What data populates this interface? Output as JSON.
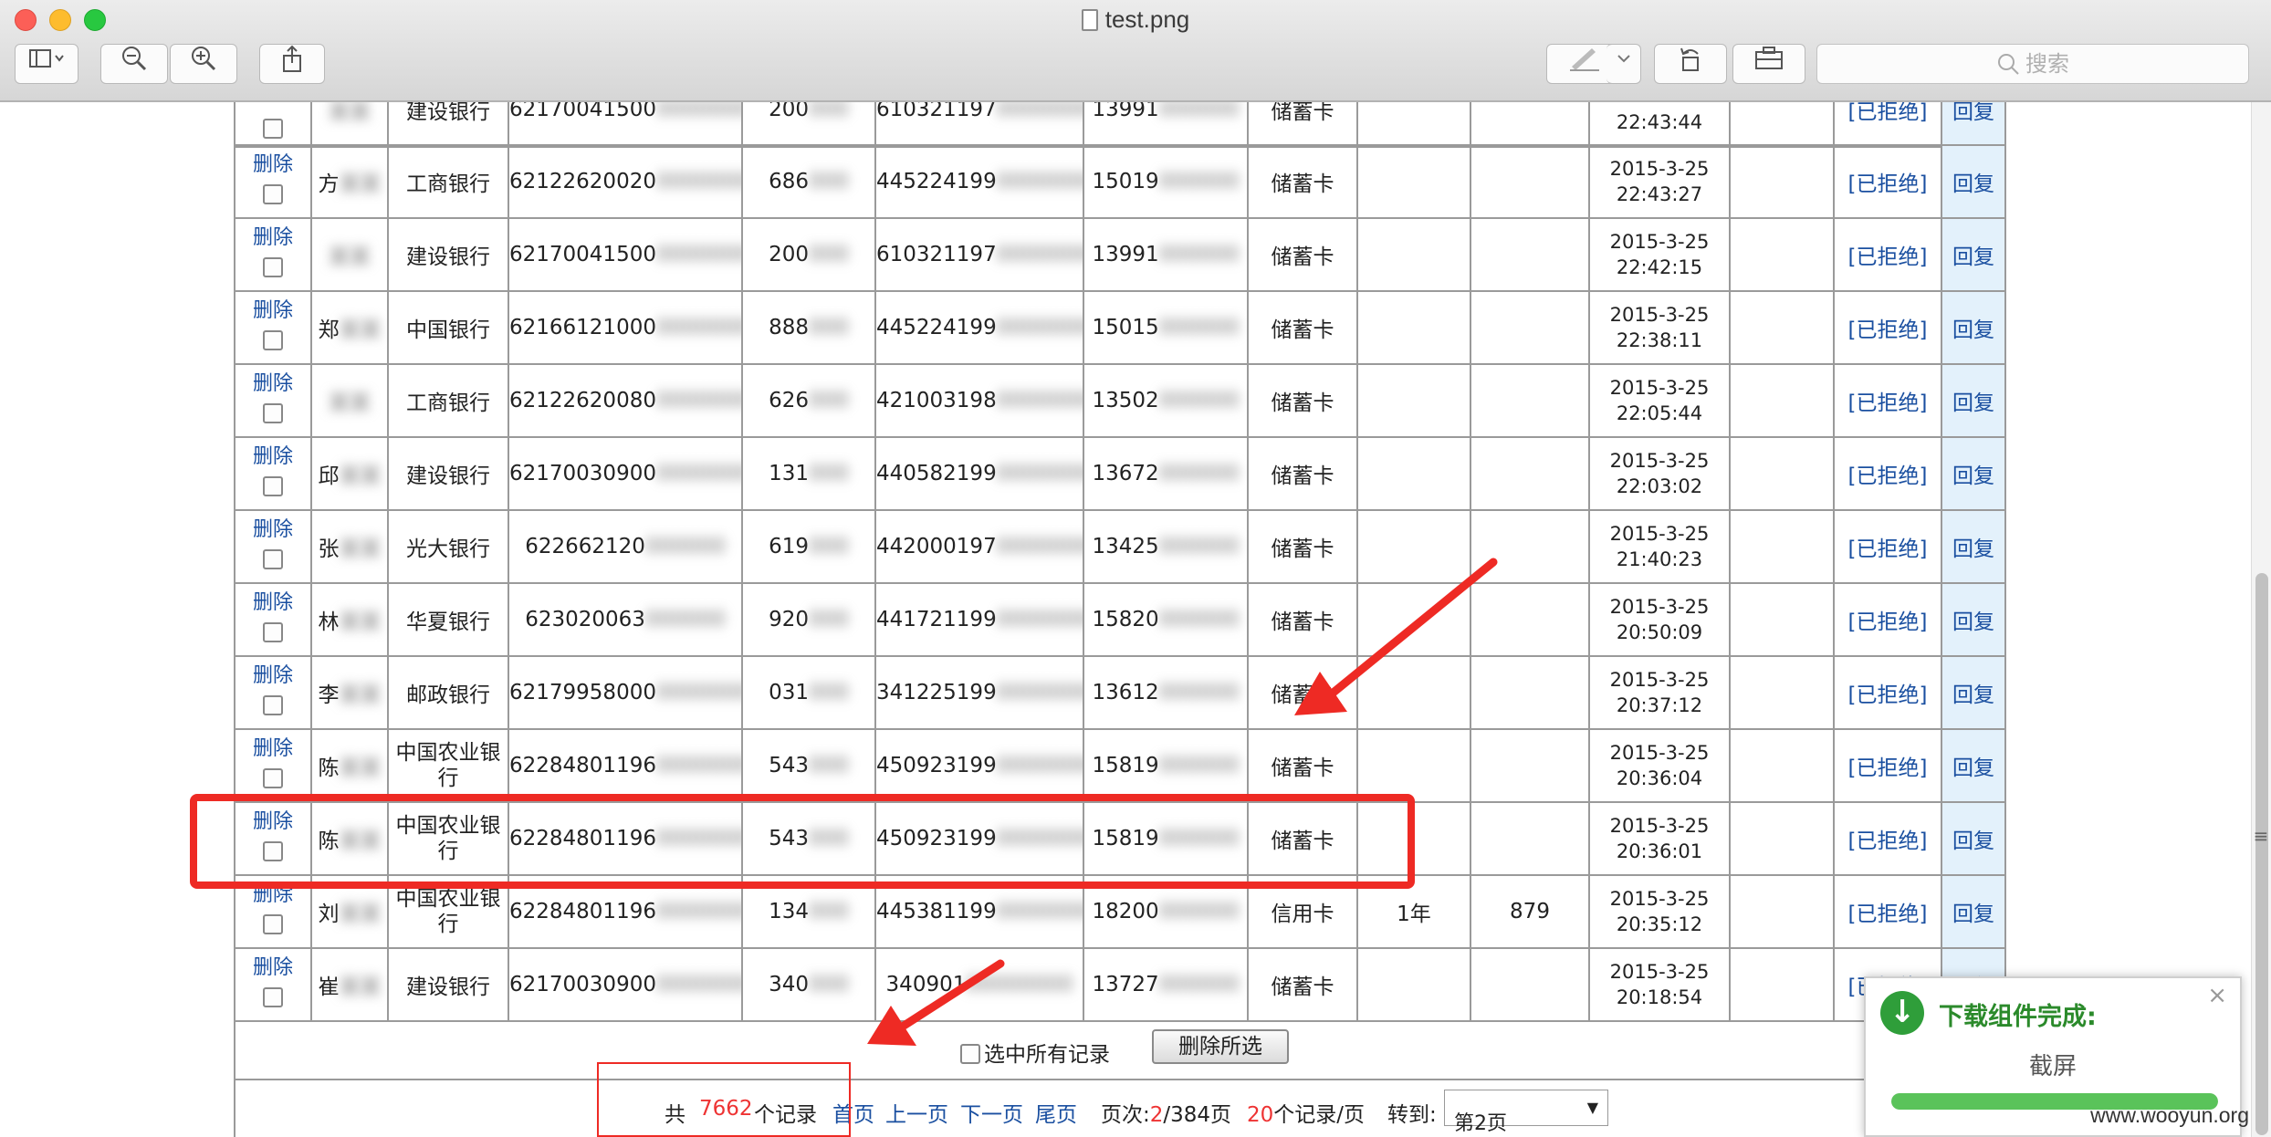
{
  "window": {
    "title": "test.png"
  },
  "toolbar": {
    "sidebar_icon": "sidebar-icon",
    "zoom_out_icon": "zoom-out-icon",
    "zoom_in_icon": "zoom-in-icon",
    "share_icon": "share-icon",
    "markup_icon": "markup-pen-icon",
    "rotate_icon": "rotate-icon",
    "toolbox_icon": "toolbox-icon",
    "search_placeholder": "搜索"
  },
  "table": {
    "rows": [
      {
        "action": "删除",
        "name": "方",
        "name_blur": "某某",
        "bank": "工商银行",
        "card": "62122620020",
        "card_blur": "00000000",
        "mid": "686",
        "mid_blur": "000",
        "id_no": "445224199",
        "id_blur": "00000000",
        "phone": "15019",
        "phone_blur": "000000",
        "type": "储蓄卡",
        "term": "",
        "amount": "",
        "date": "2015-3-25",
        "time": "22:43:27",
        "status": "[已拒绝]",
        "reply": "回复"
      },
      {
        "action": "删除",
        "name": "",
        "name_blur": "某某",
        "bank": "建设银行",
        "card": "62170041500",
        "card_blur": "0000000",
        "card_tail": "5",
        "mid": "200",
        "mid_blur": "000",
        "id_no": "610321197",
        "id_blur": "00000000",
        "phone": "13991",
        "phone_blur": "000000",
        "type": "储蓄卡",
        "term": "",
        "amount": "",
        "date": "2015-3-25",
        "time": "22:42:15",
        "status": "[已拒绝]",
        "reply": "回复"
      },
      {
        "action": "删除",
        "name": "郑",
        "name_blur": "某某",
        "bank": "中国银行",
        "card": "62166121000",
        "card_blur": "0000000",
        "card_tail": "3",
        "mid": "888",
        "mid_blur": "000",
        "id_no": "445224199",
        "id_blur": "00000000",
        "phone": "15015",
        "phone_blur": "000000",
        "type": "储蓄卡",
        "term": "",
        "amount": "",
        "date": "2015-3-25",
        "time": "22:38:11",
        "status": "[已拒绝]",
        "reply": "回复"
      },
      {
        "action": "删除",
        "name": "",
        "name_blur": "某某",
        "bank": "工商银行",
        "card": "62122620080",
        "card_blur": "0000000",
        "card_tail": "7",
        "mid": "626",
        "mid_blur": "000",
        "id_no": "421003198",
        "id_blur": "00000000",
        "phone": "13502",
        "phone_blur": "000000",
        "type": "储蓄卡",
        "term": "",
        "amount": "",
        "date": "2015-3-25",
        "time": "22:05:44",
        "status": "[已拒绝]",
        "reply": "回复"
      },
      {
        "action": "删除",
        "name": "邱",
        "name_blur": "某某",
        "bank": "建设银行",
        "card": "62170030900",
        "card_blur": "0000000",
        "card_tail": "2",
        "mid": "131",
        "mid_blur": "000",
        "id_no": "440582199",
        "id_blur": "00000000",
        "phone": "13672",
        "phone_blur": "000000",
        "type": "储蓄卡",
        "term": "",
        "amount": "",
        "date": "2015-3-25",
        "time": "22:03:02",
        "status": "[已拒绝]",
        "reply": "回复"
      },
      {
        "action": "删除",
        "name": "张",
        "name_blur": "某某",
        "bank": "光大银行",
        "card": "622662120",
        "card_blur": "000000",
        "mid": "619",
        "mid_blur": "000",
        "id_no": "442000197",
        "id_blur": "00000000",
        "phone": "13425",
        "phone_blur": "000000",
        "type": "储蓄卡",
        "term": "",
        "amount": "",
        "date": "2015-3-25",
        "time": "21:40:23",
        "status": "[已拒绝]",
        "reply": "回复"
      },
      {
        "action": "删除",
        "name": "林",
        "name_blur": "某某",
        "bank": "华夏银行",
        "card": "623020063",
        "card_blur": "000000",
        "mid": "920",
        "mid_blur": "000",
        "id_no": "441721199",
        "id_blur": "00000000",
        "phone": "15820",
        "phone_blur": "000000",
        "type": "储蓄卡",
        "term": "",
        "amount": "",
        "date": "2015-3-25",
        "time": "20:50:09",
        "status": "[已拒绝]",
        "reply": "回复"
      },
      {
        "action": "删除",
        "name": "李",
        "name_blur": "某某",
        "bank": "邮政银行",
        "card": "62179958000",
        "card_blur": "0000000",
        "card_tail": "9",
        "mid": "031",
        "mid_blur": "000",
        "id_no": "341225199",
        "id_blur": "00000000",
        "phone": "13612",
        "phone_blur": "000000",
        "type": "储蓄卡",
        "term": "",
        "amount": "",
        "date": "2015-3-25",
        "time": "20:37:12",
        "status": "[已拒绝]",
        "reply": "回复"
      },
      {
        "action": "删除",
        "name": "陈",
        "name_blur": "某某",
        "bank": "中国农业银行",
        "card": "62284801196",
        "card_blur": "0000000",
        "card_tail": "1",
        "mid": "543",
        "mid_blur": "000",
        "id_no": "450923199",
        "id_blur": "00000000",
        "phone": "15819",
        "phone_blur": "000000",
        "type": "储蓄卡",
        "term": "",
        "amount": "",
        "date": "2015-3-25",
        "time": "20:36:04",
        "status": "[已拒绝]",
        "reply": "回复"
      },
      {
        "action": "删除",
        "name": "陈",
        "name_blur": "某某",
        "bank": "中国农业银行",
        "card": "62284801196",
        "card_blur": "0000000",
        "card_tail": "1",
        "mid": "543",
        "mid_blur": "000",
        "id_no": "450923199",
        "id_blur": "00000000",
        "phone": "15819",
        "phone_blur": "000000",
        "type": "储蓄卡",
        "term": "",
        "amount": "",
        "date": "2015-3-25",
        "time": "20:36:01",
        "status": "[已拒绝]",
        "reply": "回复"
      },
      {
        "action": "删除",
        "name": "刘",
        "name_blur": "某某",
        "bank": "中国农业银行",
        "card": "62284801196",
        "card_blur": "0000000",
        "card_tail": "9",
        "mid": "134",
        "mid_blur": "000",
        "id_no": "445381199",
        "id_blur": "00000000",
        "phone": "18200",
        "phone_blur": "000000",
        "type": "信用卡",
        "term": "1年",
        "amount": "879",
        "date": "2015-3-25",
        "time": "20:35:12",
        "status": "[已拒绝]",
        "reply": "回复"
      },
      {
        "action": "删除",
        "name": "崔",
        "name_blur": "某某",
        "bank": "建设银行",
        "card": "62170030900",
        "card_blur": "0000000",
        "card_tail": "3",
        "mid": "340",
        "mid_blur": "000",
        "id_no": "340901",
        "id_blur": "00000000",
        "phone": "13727",
        "phone_blur": "000000",
        "type": "储蓄卡",
        "term": "",
        "amount": "",
        "date": "2015-3-25",
        "time": "20:18:54",
        "status": "[已拒绝]",
        "reply": "回复"
      }
    ],
    "top_partial": {
      "bank": "建设银行",
      "card": "62170041500",
      "card_tail": "5",
      "mid": "200",
      "id_no": "610321197",
      "phone": "13991",
      "type": "储蓄卡",
      "time": "22:43:44",
      "status": "[已拒绝]",
      "reply": "回复"
    }
  },
  "bulk": {
    "select_all_label": "选中所有记录",
    "delete_selected_label": "删除所选"
  },
  "pager": {
    "total_prefix": "共",
    "total_count": "7662",
    "total_suffix": "个记录",
    "first": "首页",
    "prev": "上一页",
    "next": "下一页",
    "last": "尾页",
    "page_prefix": "页次:",
    "page_current": "2",
    "page_total": "/384页",
    "per_page_count": "20",
    "per_page_suffix": "个记录/页",
    "goto_label": "转到:",
    "goto_value": "第2页"
  },
  "notification": {
    "title": "下载组件完成:",
    "name": "截屏",
    "progress": 1.0,
    "close": "×"
  },
  "watermark": "www.wooyun.org",
  "colors": {
    "annotation_red": "#ee2a24",
    "link_blue": "#1a4fa0",
    "reply_bg": "#e3f1fb",
    "count_red": "#ee3333"
  }
}
